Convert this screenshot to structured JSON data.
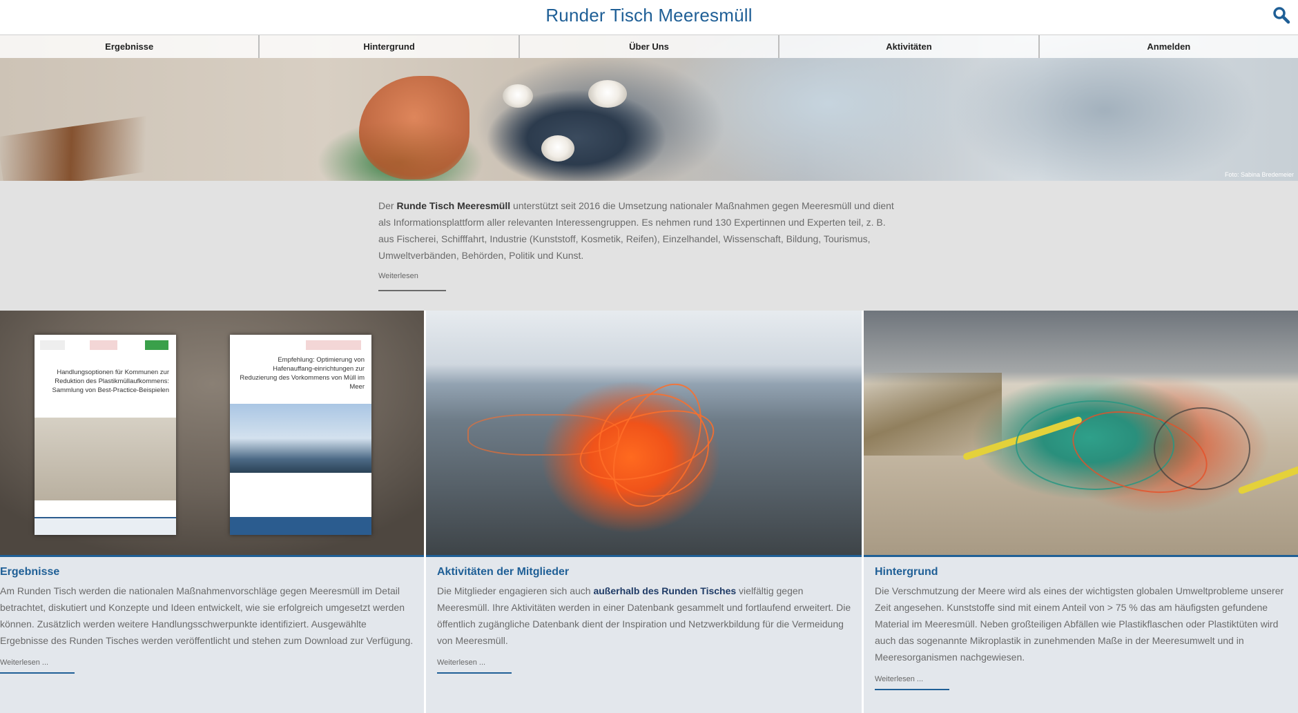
{
  "header": {
    "title": "Runder Tisch Meeresmüll",
    "search_icon": "search-icon"
  },
  "nav": {
    "items": [
      {
        "label": "Ergebnisse"
      },
      {
        "label": "Hintergrund"
      },
      {
        "label": "Über Uns"
      },
      {
        "label": "Aktivitäten"
      },
      {
        "label": "Anmelden"
      }
    ]
  },
  "hero": {
    "photo_credit": "Foto: Sabina Bredemeier"
  },
  "intro": {
    "prefix": "Der ",
    "bold": "Runde Tisch Meeresmüll",
    "text": " unterstützt seit 2016 die Umsetzung nationaler Maßnahmen gegen Meeresmüll und dient als Informationsplattform aller relevanten Interessengruppen. Es nehmen rund 130 Expertinnen und Experten teil, z. B. aus Fischerei, Schifffahrt, Industrie (Kunststoff, Kosmetik, Reifen), Einzelhandel, Wissenschaft, Bildung, Tourismus, Umweltverbänden, Behörden, Politik und Kunst.",
    "read_more": "Weiterlesen"
  },
  "cards": [
    {
      "title": "Ergebnisse",
      "text": "Am Runden Tisch werden die nationalen Maßnahmenvorschläge gegen Meeresmüll im Detail betrachtet, diskutiert und Konzepte und Ideen entwickelt, wie sie erfolgreich umgesetzt werden können. Zusätzlich werden weitere Handlungsschwerpunkte identifiziert. Ausgewählte Ergebnisse des Runden Tisches werden veröffentlicht und stehen zum Download zur Verfügung.",
      "read_more": "Weiterlesen ...",
      "brochure_1": "Handlungsoptionen für Kommunen zur Reduktion des Plastikmüllaufkommens: Sammlung von Best-Practice-Beispielen",
      "brochure_2": "Empfehlung: Optimierung von Hafenauffang-einrichtungen zur Reduzierung des Vorkommens von Müll im Meer"
    },
    {
      "title": "Aktivitäten der Mitglieder",
      "text_before": "Die Mitglieder engagieren sich auch ",
      "text_bold": "außerhalb des Runden Tisches",
      "text_after": " vielfältig gegen Meeresmüll. Ihre Aktivitäten werden in einer Datenbank gesammelt und fortlaufend erweitert. Die öffentlich zugängliche Datenbank dient der Inspiration und Netzwerkbildung für die Vermeidung von Meeresmüll.",
      "read_more": "Weiterlesen ..."
    },
    {
      "title": "Hintergrund",
      "text": "Die Verschmutzung der Meere wird als eines der wichtigsten globalen Umweltprobleme unserer Zeit angesehen. Kunststoffe sind mit einem Anteil von > 75 % das am häufigsten gefundene Material im Meeresmüll. Neben großteiligen Abfällen wie Plastikflaschen oder Plastiktüten wird auch das sogenannte Mikroplastik in zunehmenden Maße in der Meeresumwelt und in Meeresorganismen nachgewiesen.",
      "read_more": "Weiterlesen ..."
    }
  ],
  "colors": {
    "accent": "#1f5f96",
    "intro_bg": "#e2e2e2",
    "card_bg": "#e3e7ec"
  }
}
